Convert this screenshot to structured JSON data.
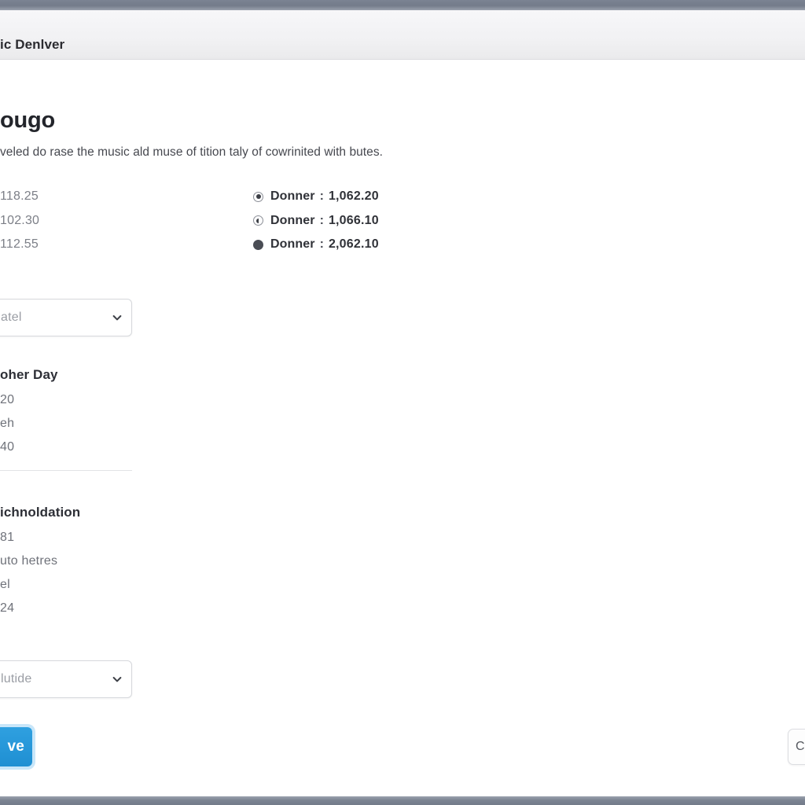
{
  "window": {
    "titlebar_color": "#737b8a",
    "statusbar_color": "#7b8392"
  },
  "header": {
    "tab_label": "ic Denlver"
  },
  "page": {
    "title": "ougo",
    "description": "veled do rase the music ald muse of tition taly of cowrinited with butes."
  },
  "amounts_left": [
    "118.25",
    "102.30",
    "112.55"
  ],
  "donations": [
    {
      "radio_state": "checked",
      "name": "Donner",
      "separator": ":",
      "amount": "1,062.20"
    },
    {
      "radio_state": "half",
      "name": "Donner",
      "separator": ":",
      "amount": "1,066.10"
    },
    {
      "radio_state": "filled",
      "name": "Donner",
      "separator": ":",
      "amount": "2,062.10"
    }
  ],
  "selects": {
    "location": {
      "value": "atel",
      "icon": "chevron-down-icon"
    },
    "frequency": {
      "value": "lutide",
      "icon": "chevron-down-icon"
    }
  },
  "blocks": {
    "schedule": {
      "heading": "oher Day",
      "lines": [
        "20",
        "eh",
        "40"
      ]
    },
    "contribution": {
      "heading": "ichnoldation",
      "lines": [
        "81",
        "uto hetres",
        "el",
        "24"
      ]
    }
  },
  "footer": {
    "save_label": "ve",
    "save_color": "#1f8fd2",
    "secondary_label": "C"
  }
}
